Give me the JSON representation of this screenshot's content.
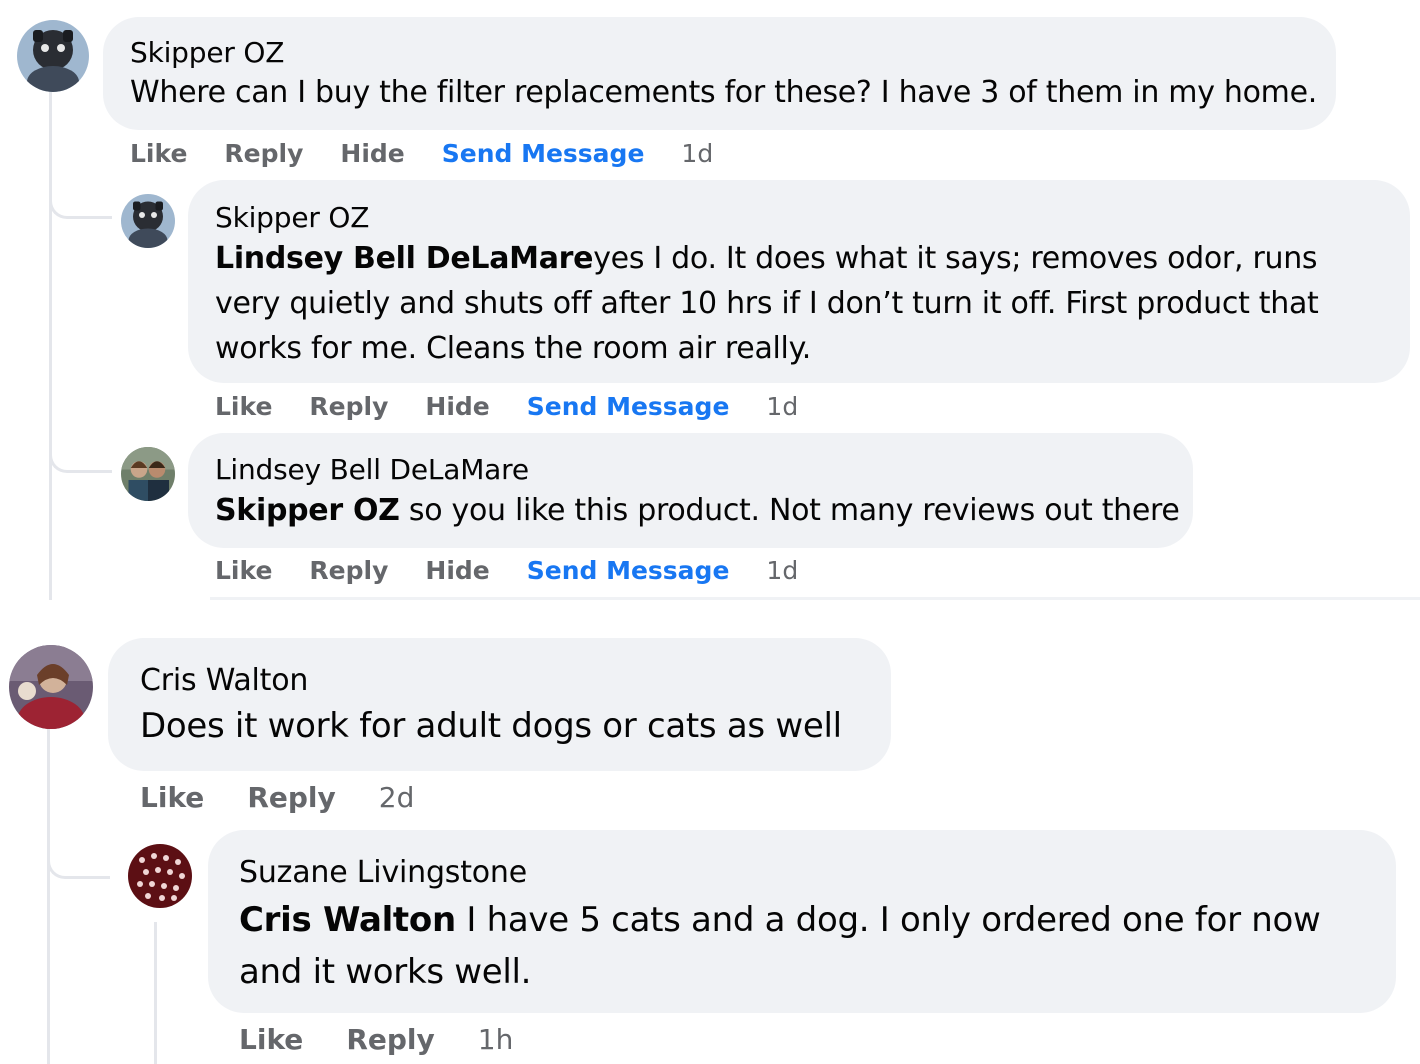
{
  "comments": [
    {
      "author": "Skipper OZ",
      "text": "Where can I buy the filter replacements for these? I have 3 of them in my home.",
      "actions": {
        "like": "Like",
        "reply": "Reply",
        "hide": "Hide",
        "send_message": "Send Message",
        "time": "1d"
      },
      "replies": [
        {
          "author": "Skipper OZ",
          "mention": "Lindsey Bell DeLaMare",
          "text": "yes I do. It does what it says; removes odor, runs very quietly and shuts off after 10 hrs if I don’t turn it off. First product that works for me. Cleans the room air really.",
          "actions": {
            "like": "Like",
            "reply": "Reply",
            "hide": "Hide",
            "send_message": "Send Message",
            "time": "1d"
          }
        },
        {
          "author": "Lindsey Bell DeLaMare",
          "mention": "Skipper OZ",
          "text": " so you like this product. Not many reviews out there",
          "actions": {
            "like": "Like",
            "reply": "Reply",
            "hide": "Hide",
            "send_message": "Send Message",
            "time": "1d"
          }
        }
      ]
    },
    {
      "author": "Cris Walton",
      "text": "Does it work for adult dogs or cats as well",
      "actions": {
        "like": "Like",
        "reply": "Reply",
        "time": "2d"
      },
      "replies": [
        {
          "author": "Suzane Livingstone",
          "mention": "Cris Walton",
          "text": " I have 5 cats and a dog. I only ordered one for now and it works well.",
          "actions": {
            "like": "Like",
            "reply": "Reply",
            "time": "1h"
          }
        }
      ]
    }
  ],
  "colors": {
    "bubble": "#f0f2f5",
    "secondary_text": "#65676b",
    "link_blue": "#1877f2",
    "thread_line": "#e4e6eb"
  }
}
